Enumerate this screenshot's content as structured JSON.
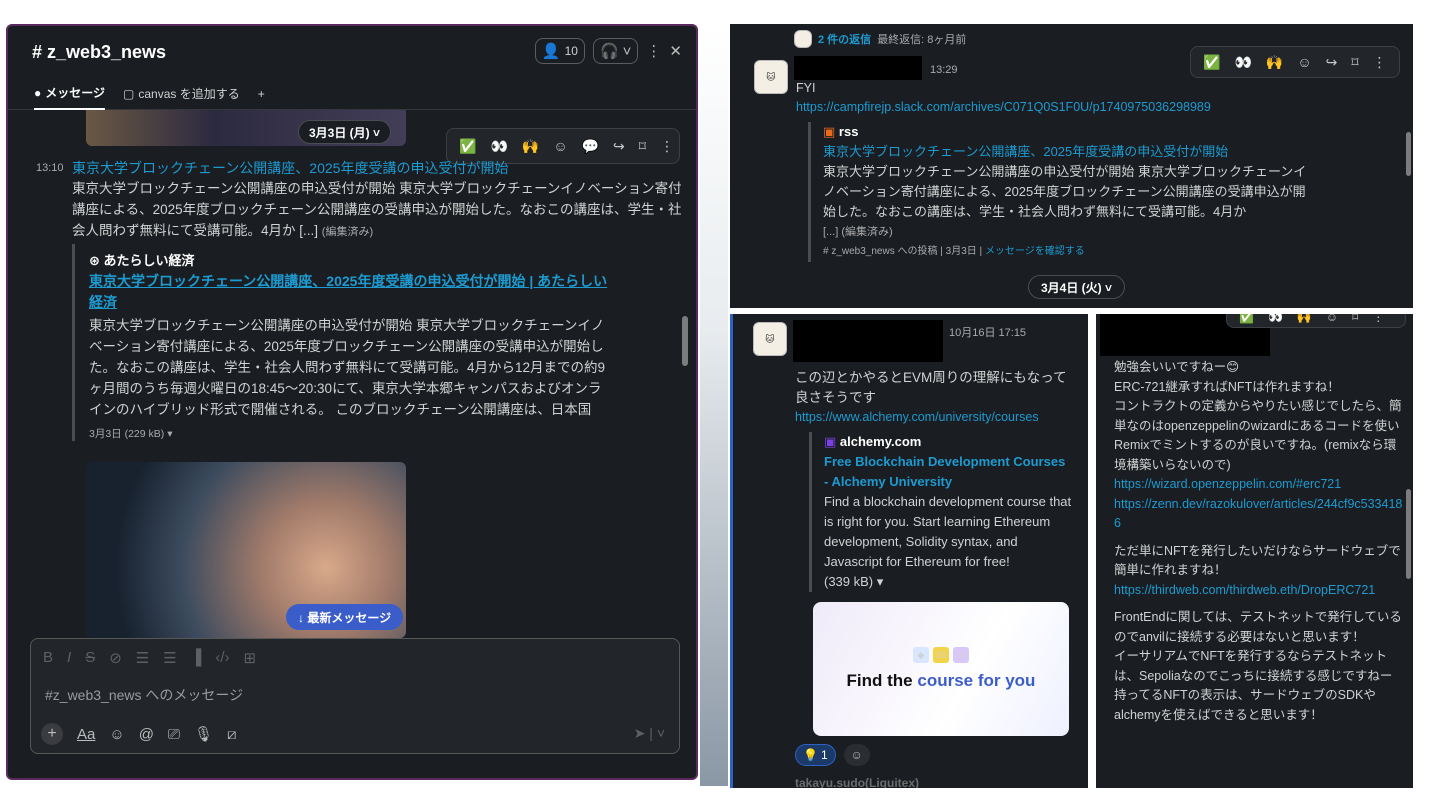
{
  "main": {
    "channel_title": "# z_web3_news",
    "member_count": "10",
    "tabs": [
      {
        "label": "メッセージ"
      },
      {
        "label": "canvas を追加する"
      }
    ],
    "date_divider": "3月3日 (月) ˅",
    "message": {
      "time": "13:10",
      "link_title": "東京大学ブロックチェーン公開講座、2025年度受講の申込受付が開始",
      "body": "東京大学ブロックチェーン公開講座の申込受付が開始 東京大学ブロックチェーンイノベーション寄付講座による、2025年度ブロックチェーン公開講座の受講申込が開始した。なおこの講座は、学生・社会人問わず無料にて受講可能。4月か [...]",
      "edited": "(編集済み)",
      "attachment": {
        "source": "あたらしい経済",
        "title": "東京大学ブロックチェーン公開講座、2025年度受講の申込受付が開始 | あたらしい経済",
        "description": "東京大学ブロックチェーン公開講座の申込受付が開始 東京大学ブロックチェーンイノベーション寄付講座による、2025年度ブロックチェーン公開講座の受講申込が開始した。なおこの講座は、学生・社会人問わず無料にて受講可能。4月から12月までの約9ヶ月間のうち毎週火曜日の18:45〜20:30にて、東京大学本郷キャンパスおよびオンラインのハイブリッド形式で開催される。 このブロックチェーン公開講座は、日本国",
        "meta": "3月3日 (229 kB) ▾"
      }
    },
    "jump_button": "↓ 最新メッセージ",
    "composer_placeholder": "#z_web3_news へのメッセージ"
  },
  "right_top": {
    "reply_count": "2 件の返信",
    "reply_last": "最終返信: 8ヶ月前",
    "time": "13:29",
    "fyi": "FYI",
    "url": "https://campfirejp.slack.com/archives/C071Q0S1F0U/p1740975036298989",
    "attachment": {
      "source": "rss",
      "title": "東京大学ブロックチェーン公開講座、2025年度受講の申込受付が開始",
      "description": "東京大学ブロックチェーン公開講座の申込受付が開始 東京大学ブロックチェーンイノベーション寄付講座による、2025年度ブロックチェーン公開講座の受講申込が開始した。なおこの講座は、学生・社会人問わず無料にて受講可能。4月か",
      "more": "[...] (編集済み)",
      "meta_left": "# z_web3_news への投稿 | 3月3日 | ",
      "meta_link": "メッセージを確認する"
    },
    "date_divider": "3月4日 (火) ˅"
  },
  "right_bottom_left": {
    "time": "10月16日 17:15",
    "body": "この辺とかやるとEVM周りの理解にもなって良さそうです",
    "url": "https://www.alchemy.com/university/courses",
    "attachment": {
      "source": "alchemy.com",
      "title": "Free Blockchain Development Courses - Alchemy University",
      "description": "Find a blockchain development course that is right for you. Start learning Ethereum development, Solidity syntax, and Javascript for Ethereum for free!",
      "size": "(339 kB) ▾"
    },
    "card": {
      "text_a": "Find the ",
      "text_b": "course for you"
    },
    "reaction_count": "1",
    "next_author": "takayu.sudo(Liquitex)"
  },
  "right_bottom_right": {
    "lines": [
      "勉強会いいですねー😊",
      "ERC-721継承すればNFTは作れますね！",
      "コントラクトの定義からやりたい感じでしたら、簡単なのはopenzeppelinのwizardにあるコードを使いRemixでミントするのが良いですね。(remixなら環境構築いらないので)"
    ],
    "links": [
      "https://wizard.openzeppelin.com/#erc721",
      "https://zenn.dev/razokulover/articles/244cf9c5334186"
    ],
    "p2": "ただ単にNFTを発行したいだけならサードウェブで簡単に作れますね！",
    "link3": "https://thirdweb.com/thirdweb.eth/DropERC721",
    "p3": "FrontEndに関しては、テストネットで発行しているのでanvilに接続する必要はないと思います！",
    "p4": "イーサリアムでNFTを発行するならテストネットは、Sepoliaなのでこっちに接続する感じですねー",
    "p5": "持ってるNFTの表示は、サードウェブのSDKやalchemyを使えばできると思います！"
  },
  "colors": {
    "bg": "#1a1d21",
    "link": "#1d9bd1",
    "accent": "#3b5dc9",
    "border": "#5a2a5e"
  }
}
